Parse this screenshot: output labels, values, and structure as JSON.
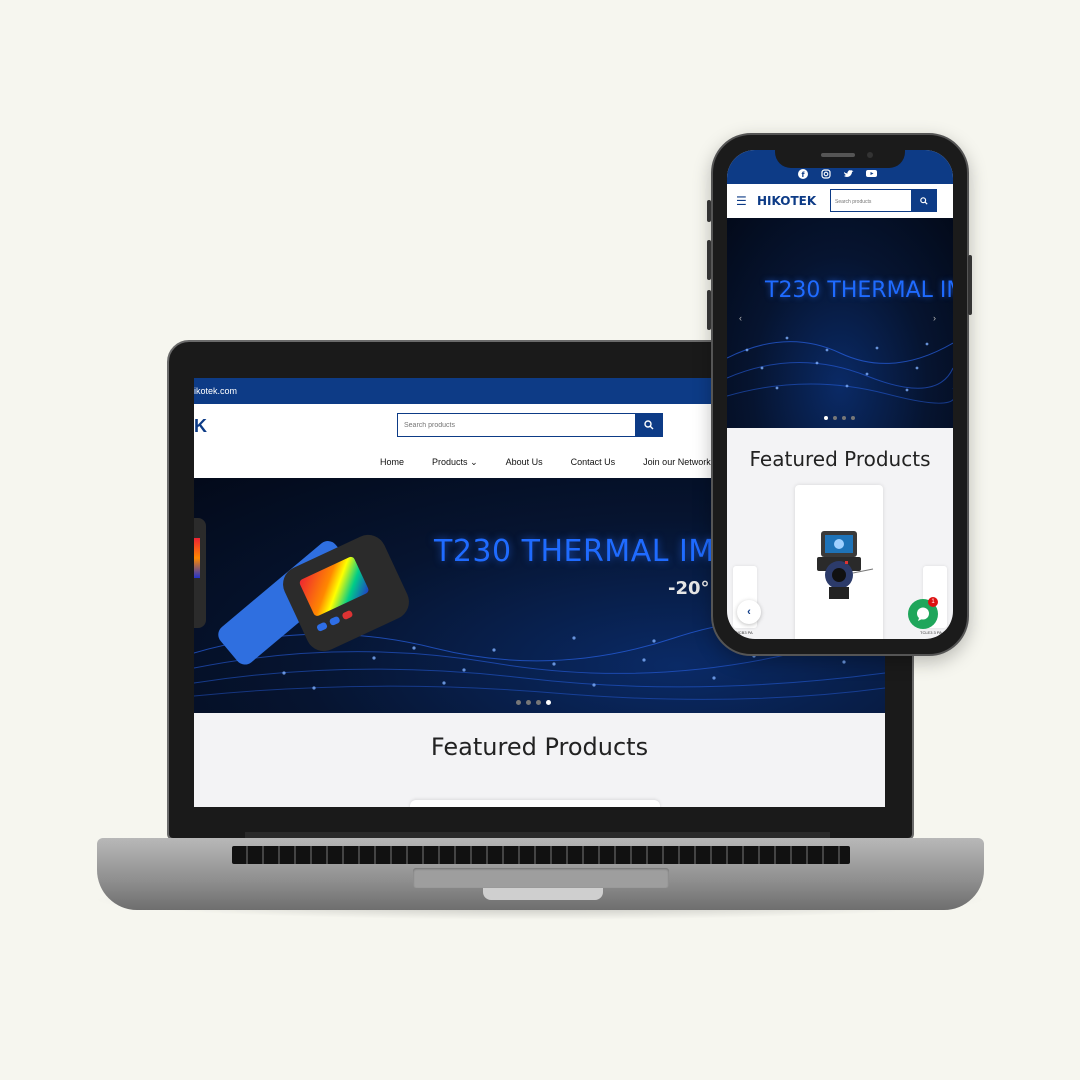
{
  "laptop": {
    "topbar_text": "ikotek.com",
    "logo_text": "K",
    "search": {
      "placeholder": "Search products"
    },
    "nav": {
      "home": "Home",
      "products": "Products",
      "about": "About Us",
      "contact": "Contact Us",
      "network": "Join our Network"
    },
    "hero": {
      "title": "T230 THERMAL IMA",
      "subtitle": "-20°",
      "slide_count": 4,
      "active_slide": 4
    },
    "featured_title": "Featured Products"
  },
  "phone": {
    "social_icons": [
      "facebook-icon",
      "instagram-icon",
      "twitter-icon",
      "youtube-icon"
    ],
    "logo_text": "HIKOTEK",
    "search": {
      "placeholder": "Search products"
    },
    "hero": {
      "title": "T230 THERMAL IM",
      "slide_count": 4,
      "active_slide": 1
    },
    "featured_title": "Featured Products",
    "side_left_label": "WCB3 PA",
    "side_right_label": "TCLE3 3 PA",
    "chat_badge": "1"
  },
  "colors": {
    "brand": "#0d3b86",
    "hero_title": "#1f6bff",
    "background": "#f6f6ef",
    "chat": "#1fa65b",
    "badge": "#dd1111"
  }
}
